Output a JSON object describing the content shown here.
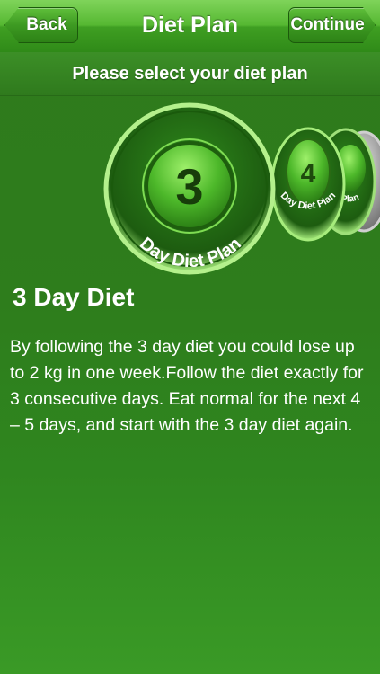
{
  "nav": {
    "title": "Diet Plan",
    "back_label": "Back",
    "continue_label": "Continue"
  },
  "subtitle": "Please select your diet plan",
  "carousel": {
    "items": [
      {
        "number": "3",
        "label": "Day Diet Plan",
        "selected": true
      },
      {
        "number": "4",
        "label": "Day Diet Plan",
        "selected": false
      },
      {
        "number": "",
        "label": "Plan",
        "selected": false
      }
    ]
  },
  "plan": {
    "title": "3 Day Diet",
    "description": "By following the 3 day diet you could lose up to 2 kg in one week.Follow the diet exactly for 3 consecutive days. Eat normal for the next 4 – 5 days, and start with the 3 day diet again."
  },
  "colors": {
    "accent": "#4caf2a",
    "background": "#2e7d1c",
    "text": "#ffffff"
  }
}
